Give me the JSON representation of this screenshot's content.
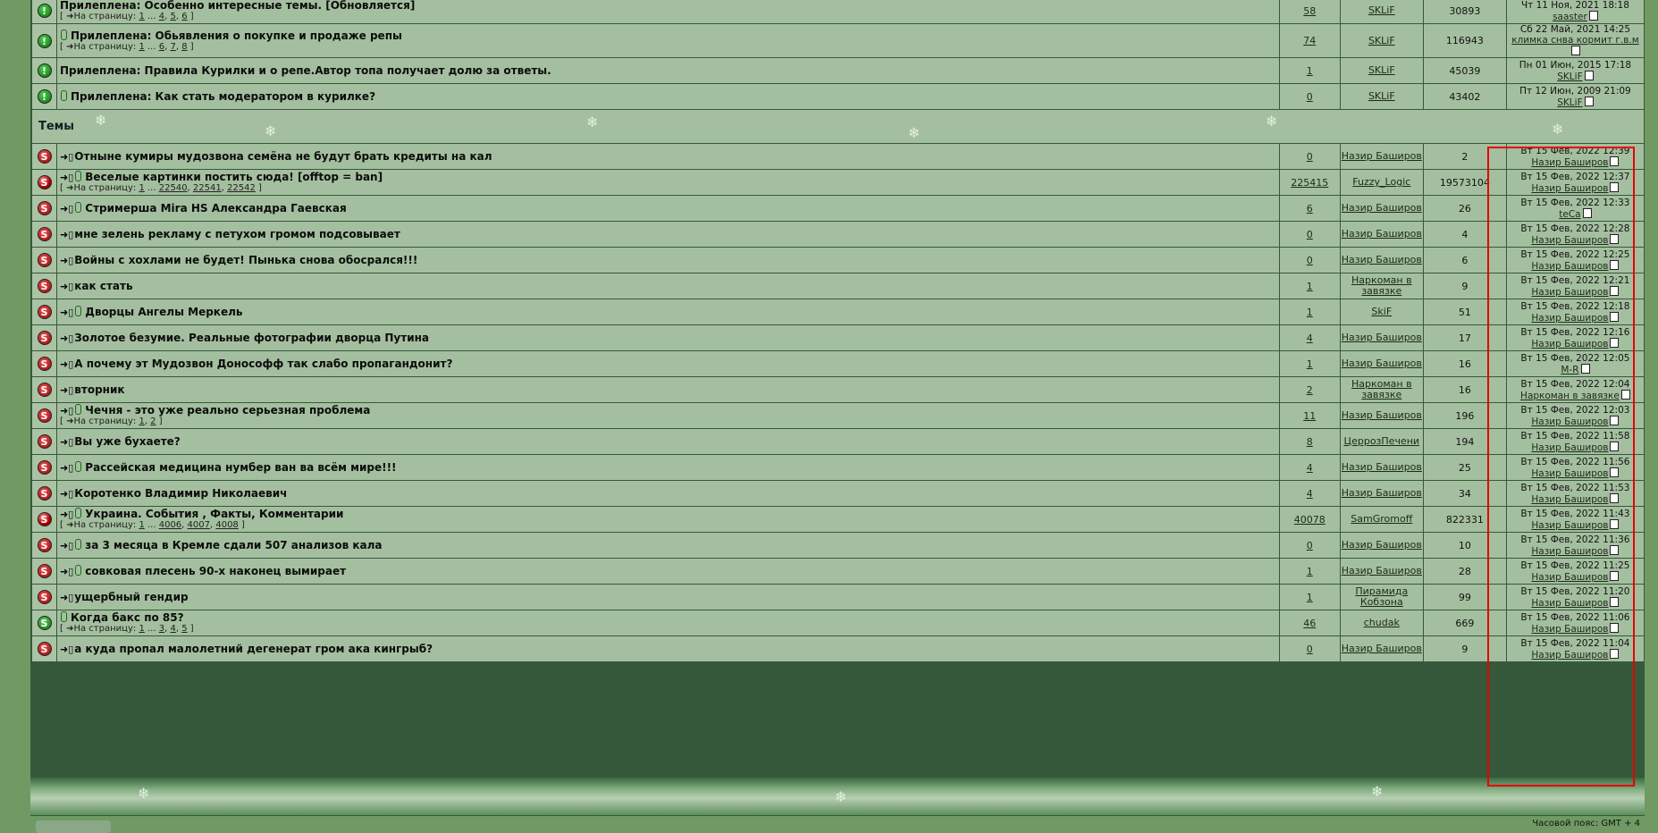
{
  "sticky": [
    {
      "prefix": "Прилеплена:",
      "title": "Особенно интересные темы. [Обновляется]",
      "attach": false,
      "pages": [
        "1",
        "4",
        "5",
        "6"
      ],
      "replies": "58",
      "author": "SKLiF",
      "views": "30893",
      "last_date": "Чт 11 Ноя, 2021 18:18",
      "last_user": "saaster"
    },
    {
      "prefix": "Прилеплена:",
      "title": "Обьявления о покупке и продаже репы",
      "attach": true,
      "pages": [
        "1",
        "6",
        "7",
        "8"
      ],
      "replies": "74",
      "author": "SKLiF",
      "views": "116943",
      "last_date": "Сб 22 Май, 2021 14:25",
      "last_user": "климка снва кормит г.в.м"
    },
    {
      "prefix": "Прилеплена:",
      "title": "Правила Курилки и о репе.Автор топа получает долю за ответы.",
      "attach": false,
      "pages": [],
      "replies": "1",
      "author": "SKLiF",
      "views": "45039",
      "last_date": "Пн 01 Июн, 2015 17:18",
      "last_user": "SKLiF"
    },
    {
      "prefix": "Прилеплена:",
      "title": "Как стать модератором в курилке?",
      "attach": true,
      "pages": [],
      "replies": "0",
      "author": "SKLiF",
      "views": "43402",
      "last_date": "Пт 12 Июн, 2009 21:09",
      "last_user": "SKLiF"
    }
  ],
  "section_label": "Темы",
  "pages_prefix": "На страницу:",
  "topics": [
    {
      "icon": "s-red",
      "title": "Отныне кумиры мудозвона семёна не будут брать кредиты на кал",
      "attach": false,
      "pages": [],
      "replies": "0",
      "author": "Назир Баширов",
      "views": "2",
      "last_date": "Вт 15 Фев, 2022 12:39",
      "last_user": "Назир Баширов"
    },
    {
      "icon": "hot",
      "title": "Веселые картинки постить сюда! [offtop = ban]",
      "attach": true,
      "pages": [
        "1",
        "22540",
        "22541",
        "22542"
      ],
      "replies": "225415",
      "author": "Fuzzy_Logic",
      "views": "19573104",
      "last_date": "Вт 15 Фев, 2022 12:37",
      "last_user": "Назир Баширов"
    },
    {
      "icon": "s-red",
      "title": "Стримерша Mira HS Александра Гаевская",
      "attach": true,
      "pages": [],
      "replies": "6",
      "author": "Назир Баширов",
      "views": "26",
      "last_date": "Вт 15 Фев, 2022 12:33",
      "last_user": "teCa"
    },
    {
      "icon": "s-red",
      "title": "мне зелень рекламу с петухом громом подсовывает",
      "attach": false,
      "pages": [],
      "replies": "0",
      "author": "Назир Баширов",
      "views": "4",
      "last_date": "Вт 15 Фев, 2022 12:28",
      "last_user": "Назир Баширов"
    },
    {
      "icon": "s-red",
      "title": "Войны с хохлами не будет! Пынька снова обосрался!!!",
      "attach": false,
      "pages": [],
      "replies": "0",
      "author": "Назир Баширов",
      "views": "6",
      "last_date": "Вт 15 Фев, 2022 12:25",
      "last_user": "Назир Баширов"
    },
    {
      "icon": "s-red",
      "title": "как стать",
      "attach": false,
      "pages": [],
      "replies": "1",
      "author": "Наркоман в завязке",
      "views": "9",
      "last_date": "Вт 15 Фев, 2022 12:21",
      "last_user": "Назир Баширов"
    },
    {
      "icon": "s-red",
      "title": "Дворцы Ангелы Меркель",
      "attach": true,
      "pages": [],
      "replies": "1",
      "author": "SkiF",
      "views": "51",
      "last_date": "Вт 15 Фев, 2022 12:18",
      "last_user": "Назир Баширов"
    },
    {
      "icon": "s-red",
      "title": "Золотое безумие. Реальные фотографии дворца Путина",
      "attach": false,
      "pages": [],
      "replies": "4",
      "author": "Назир Баширов",
      "views": "17",
      "last_date": "Вт 15 Фев, 2022 12:16",
      "last_user": "Назир Баширов"
    },
    {
      "icon": "s-red",
      "title": "А почему эт Мудозвон Донософф так слабо пропагандонит?",
      "attach": false,
      "pages": [],
      "replies": "1",
      "author": "Назир Баширов",
      "views": "16",
      "last_date": "Вт 15 Фев, 2022 12:05",
      "last_user": "M-R"
    },
    {
      "icon": "s-red",
      "title": "вторник",
      "attach": false,
      "pages": [],
      "replies": "2",
      "author": "Наркоман в завязке",
      "views": "16",
      "last_date": "Вт 15 Фев, 2022 12:04",
      "last_user": "Наркоман в завязке"
    },
    {
      "icon": "s-red",
      "title": "Чечня - это уже реально серьезная проблема",
      "attach": true,
      "pages": [
        "1",
        "2"
      ],
      "replies": "11",
      "author": "Назир Баширов",
      "views": "196",
      "last_date": "Вт 15 Фев, 2022 12:03",
      "last_user": "Назир Баширов"
    },
    {
      "icon": "s-red",
      "title": "Вы уже бухаете?",
      "attach": false,
      "pages": [],
      "replies": "8",
      "author": "ЦеррозПечени",
      "views": "194",
      "last_date": "Вт 15 Фев, 2022 11:58",
      "last_user": "Назир Баширов"
    },
    {
      "icon": "s-red",
      "title": "Рассейская медицина нумбер ван ва всём мире!!!",
      "attach": true,
      "pages": [],
      "replies": "4",
      "author": "Назир Баширов",
      "views": "25",
      "last_date": "Вт 15 Фев, 2022 11:56",
      "last_user": "Назир Баширов"
    },
    {
      "icon": "s-red",
      "title": "Коротенко Владимир Николаевич",
      "attach": false,
      "pages": [],
      "replies": "4",
      "author": "Назир Баширов",
      "views": "34",
      "last_date": "Вт 15 Фев, 2022 11:53",
      "last_user": "Назир Баширов"
    },
    {
      "icon": "hot",
      "title": "Украина. События , Факты, Комментарии",
      "attach": true,
      "pages": [
        "1",
        "4006",
        "4007",
        "4008"
      ],
      "replies": "40078",
      "author": "SamGromoff",
      "views": "822331",
      "last_date": "Вт 15 Фев, 2022 11:43",
      "last_user": "Назир Баширов"
    },
    {
      "icon": "s-red",
      "title": "за 3 месяца в Кремле сдали 507 анализов кала",
      "attach": true,
      "pages": [],
      "replies": "0",
      "author": "Назир Баширов",
      "views": "10",
      "last_date": "Вт 15 Фев, 2022 11:36",
      "last_user": "Назир Баширов"
    },
    {
      "icon": "s-red",
      "title": "совковая плесень 90-х наконец вымирает",
      "attach": true,
      "pages": [],
      "replies": "1",
      "author": "Назир Баширов",
      "views": "28",
      "last_date": "Вт 15 Фев, 2022 11:25",
      "last_user": "Назир Баширов"
    },
    {
      "icon": "s-red",
      "title": "ущербный гендир",
      "attach": false,
      "pages": [],
      "replies": "1",
      "author": "Пирамида Кобзона",
      "views": "99",
      "last_date": "Вт 15 Фев, 2022 11:20",
      "last_user": "Назир Баширов"
    },
    {
      "icon": "s-green",
      "title": "Когда бакс по 85?",
      "attach": true,
      "noarrow": true,
      "pages": [
        "1",
        "3",
        "4",
        "5"
      ],
      "replies": "46",
      "author": "chudak",
      "views": "669",
      "last_date": "Вт 15 Фев, 2022 11:06",
      "last_user": "Назир Баширов"
    },
    {
      "icon": "s-red",
      "title": "а куда пропал малолетний дегенерат гром ака кингрыб?",
      "attach": false,
      "pages": [],
      "replies": "0",
      "author": "Назир Баширов",
      "views": "9",
      "last_date": "Вт 15 Фев, 2022 11:04",
      "last_user": "Назир Баширов"
    }
  ],
  "footer": {
    "timezone": "Часовой пояс: GMT + 4"
  }
}
